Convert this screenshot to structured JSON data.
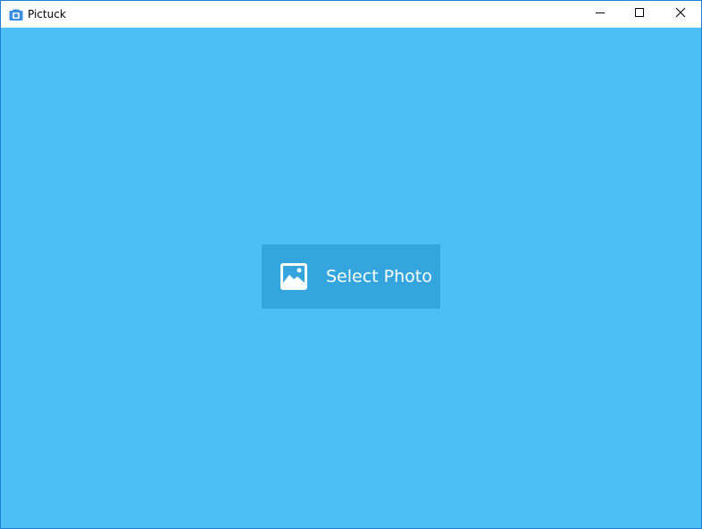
{
  "window": {
    "title": "Pictuck",
    "app_icon": "camera-icon",
    "controls": {
      "minimize": "minimize-icon",
      "maximize": "maximize-icon",
      "close": "close-icon"
    }
  },
  "main": {
    "select_photo_label": "Select Photo",
    "select_photo_icon": "image-icon"
  },
  "colors": {
    "background": "#4dbff5",
    "button_background": "#34a6dd",
    "button_text": "#ffffff",
    "titlebar": "#ffffff",
    "app_icon": "#3a8fe0"
  }
}
